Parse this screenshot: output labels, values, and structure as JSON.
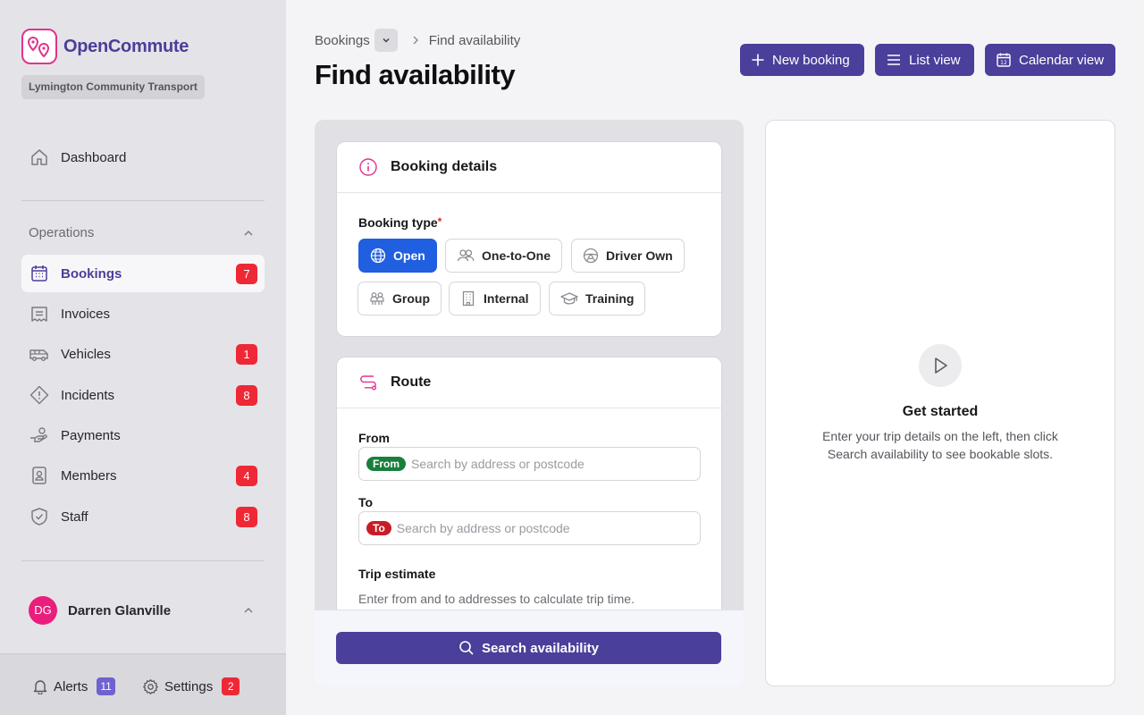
{
  "app": {
    "name": "OpenCommute",
    "org": "Lymington Community Transport"
  },
  "sidebar": {
    "dashboard": {
      "label": "Dashboard",
      "icon": "home-icon"
    },
    "section": "Operations",
    "items": [
      {
        "label": "Bookings",
        "icon": "calendar-icon",
        "badge": "7",
        "active": true
      },
      {
        "label": "Invoices",
        "icon": "receipt-icon",
        "badge": ""
      },
      {
        "label": "Vehicles",
        "icon": "bus-icon",
        "badge": "1"
      },
      {
        "label": "Incidents",
        "icon": "warning-icon",
        "badge": "8"
      },
      {
        "label": "Payments",
        "icon": "hand-coins-icon",
        "badge": ""
      },
      {
        "label": "Members",
        "icon": "id-card-icon",
        "badge": "4"
      },
      {
        "label": "Staff",
        "icon": "shield-icon",
        "badge": "8"
      }
    ],
    "user": {
      "initials": "DG",
      "name": "Darren Glanville"
    },
    "footer": {
      "alerts": {
        "label": "Alerts",
        "count": "11"
      },
      "settings": {
        "label": "Settings",
        "count": "2"
      }
    }
  },
  "header": {
    "breadcrumb": {
      "parent": "Bookings",
      "current": "Find availability"
    },
    "title": "Find availability",
    "buttons": {
      "new_booking": "New booking",
      "list_view": "List view",
      "calendar_view": "Calendar view"
    }
  },
  "booking_details": {
    "title": "Booking details",
    "type_label": "Booking type",
    "required_mark": "*",
    "types": [
      {
        "label": "Open",
        "icon": "globe-icon",
        "selected": true
      },
      {
        "label": "One-to-One",
        "icon": "users-icon"
      },
      {
        "label": "Driver Own",
        "icon": "steering-wheel-icon"
      },
      {
        "label": "Group",
        "icon": "group-icon"
      },
      {
        "label": "Internal",
        "icon": "building-icon"
      },
      {
        "label": "Training",
        "icon": "graduation-cap-icon"
      }
    ]
  },
  "route": {
    "title": "Route",
    "from": {
      "label": "From",
      "tag": "From",
      "placeholder": "Search by address or postcode"
    },
    "to": {
      "label": "To",
      "tag": "To",
      "placeholder": "Search by address or postcode"
    },
    "trip_estimate": {
      "label": "Trip estimate",
      "hint": "Enter from and to addresses to calculate trip time."
    }
  },
  "search_button": "Search availability",
  "empty_state": {
    "title": "Get started",
    "description": "Enter your trip details on the left, then click Search availability to see bookable slots."
  },
  "colors": {
    "primary": "#4a3f9a",
    "accent": "#e1338c",
    "selected": "#1f5fe0",
    "badge": "#ef2836",
    "from_tag": "#1a7f3c",
    "to_tag": "#c81d25",
    "alerts_badge": "#6e62d0"
  }
}
